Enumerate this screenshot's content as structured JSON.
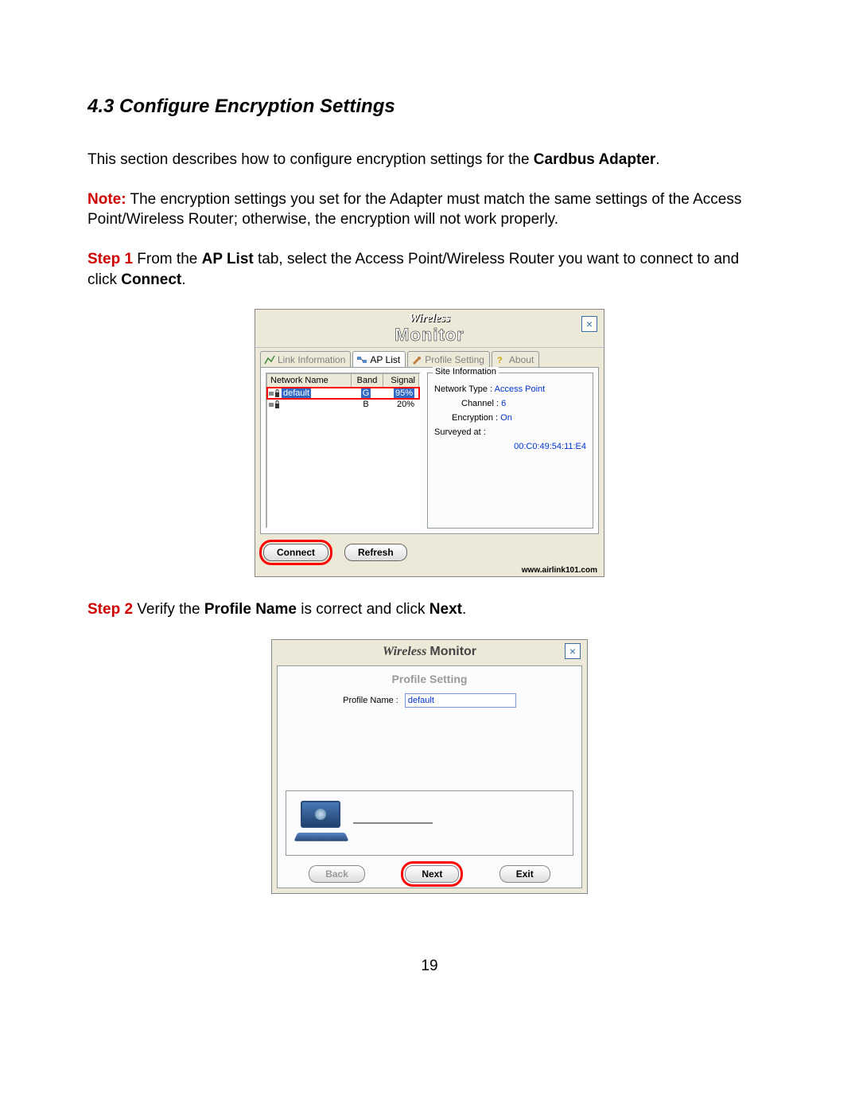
{
  "section": {
    "heading": "4.3 Configure Encryption Settings",
    "intro_pre": "This section describes how to configure encryption settings for the ",
    "intro_bold": "Cardbus Adapter",
    "intro_post": ".",
    "note_label": "Note:",
    "note_text": " The encryption settings you set for the Adapter must match the same settings of the Access Point/Wireless Router; otherwise, the encryption will not work properly.",
    "step1_label": "Step 1",
    "step1_a": " From the ",
    "step1_bold1": "AP List",
    "step1_b": " tab, select the Access Point/Wireless Router you want to connect to and click ",
    "step1_bold2": "Connect",
    "step1_c": ".",
    "step2_label": "Step 2",
    "step2_a": " Verify the ",
    "step2_bold1": "Profile Name",
    "step2_b": " is correct and click ",
    "step2_bold2": "Next",
    "step2_c": "."
  },
  "window1": {
    "logo_wireless": "Wireless",
    "logo_monitor": "Monitor",
    "close": "×",
    "tabs": {
      "link": "Link Information",
      "aplist": "AP List",
      "profile": "Profile Setting",
      "about": "About"
    },
    "list": {
      "h_name": "Network Name",
      "h_band": "Band",
      "h_signal": "Signal",
      "rows": [
        {
          "name": "default",
          "band": "G",
          "signal": "95%",
          "selected": true
        },
        {
          "name": "",
          "band": "B",
          "signal": "20%",
          "selected": false
        }
      ]
    },
    "siteinfo": {
      "legend": "Site Information",
      "ntype_label": "Network Type :",
      "ntype_val": "Access Point",
      "chan_label": "Channel :",
      "chan_val": "6",
      "enc_label": "Encryption :",
      "enc_val": "On",
      "surv_label": "Surveyed at :",
      "surv_val": "00:C0:49:54:11:E4"
    },
    "connect": "Connect",
    "refresh": "Refresh",
    "footer": "www.airlink101.com"
  },
  "window2": {
    "title_a": "Wireless",
    "title_b": "Monitor",
    "close": "×",
    "profile_heading": "Profile Setting",
    "profile_name_label": "Profile Name :",
    "profile_name_value": "default",
    "back": "Back",
    "next": "Next",
    "exit": "Exit"
  },
  "page_number": "19"
}
